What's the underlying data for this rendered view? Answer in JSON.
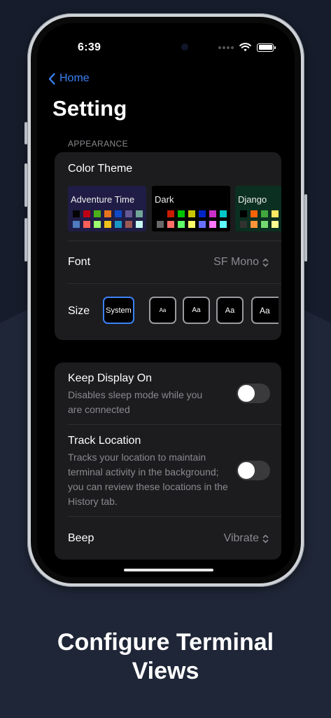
{
  "status_bar": {
    "time": "6:39"
  },
  "nav": {
    "back_label": "Home"
  },
  "page": {
    "title": "Setting"
  },
  "appearance": {
    "section_label": "APPEARANCE",
    "color_theme_label": "Color Theme",
    "themes": [
      {
        "name": "Adventure Time",
        "bg": "#1f1d45",
        "row1": [
          "#050404",
          "#bd0013",
          "#4ab118",
          "#e7741e",
          "#0f4ac6",
          "#665993",
          "#70a598",
          "#f8dcc0"
        ],
        "row2": [
          "#4e7cbf",
          "#fc5f5a",
          "#9eff6e",
          "#efc11a",
          "#1997c6",
          "#9b5953",
          "#c8faf4",
          "#f6f5fb"
        ]
      },
      {
        "name": "Dark",
        "bg": "#000000",
        "row1": [
          "#000000",
          "#c91b00",
          "#00c200",
          "#c7c400",
          "#0225c7",
          "#c930c7",
          "#00c5c7",
          "#c7c7c7"
        ],
        "row2": [
          "#686868",
          "#ff6e67",
          "#5ffa68",
          "#fffc67",
          "#6871ff",
          "#ff77ff",
          "#60fdff",
          "#ffffff"
        ]
      },
      {
        "name": "Django",
        "bg": "#0b2f20",
        "row1": [
          "#000000",
          "#fd6209",
          "#41a83e",
          "#ffe862",
          "#245032",
          "#f8f8f8",
          "#9df39f",
          "#ffffff"
        ],
        "row2": [
          "#323232",
          "#ff943b",
          "#73da70",
          "#ffff94",
          "#568264",
          "#ffffff",
          "#cfffd1",
          "#ffffff"
        ]
      }
    ],
    "font_label": "Font",
    "font_value": "SF Mono",
    "size_label": "Size",
    "size_options": [
      {
        "label": "System",
        "selected": true
      },
      {
        "label": "Aa",
        "selected": false
      },
      {
        "label": "Aa",
        "selected": false
      },
      {
        "label": "Aa",
        "selected": false
      },
      {
        "label": "Aa",
        "selected": false
      }
    ]
  },
  "options": {
    "keep_display": {
      "title": "Keep Display On",
      "description_line1": "Disables sleep mode while you",
      "description_line2": "are connected",
      "enabled": false
    },
    "track_location": {
      "title": "Track Location",
      "description_line1": "Tracks your location to maintain",
      "description_line2": "terminal activity in the background;",
      "description_line3": "you can review these locations in the",
      "description_line4": "History tab.",
      "enabled": false
    },
    "beep": {
      "label": "Beep",
      "value": "Vibrate"
    }
  },
  "caption": {
    "line1": "Configure Terminal",
    "line2": "Views"
  },
  "colors": {
    "accent": "#3b82f6",
    "background": "#1f2637",
    "card": "#1c1c1e"
  }
}
